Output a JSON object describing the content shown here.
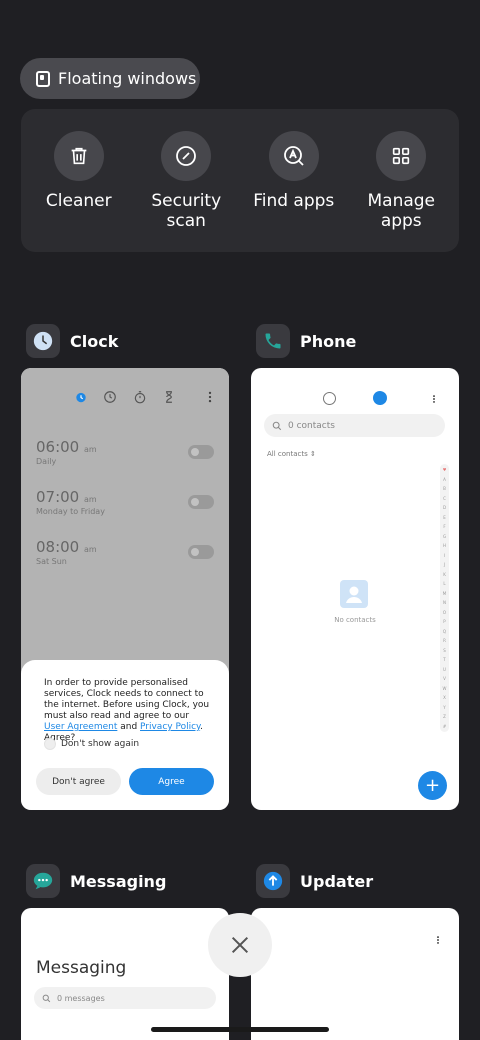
{
  "floating_windows": {
    "label": "Floating windows"
  },
  "quick_actions": [
    {
      "label": "Cleaner",
      "icon": "trash-icon"
    },
    {
      "label": "Security\nscan",
      "icon": "security-scan-icon"
    },
    {
      "label": "Find apps",
      "icon": "find-apps-icon"
    },
    {
      "label": "Manage\napps",
      "icon": "grid-icon"
    }
  ],
  "apps": {
    "clock": {
      "name": "Clock",
      "alarms": [
        {
          "time": "06:00",
          "ampm": "am",
          "repeat": "Daily"
        },
        {
          "time": "07:00",
          "ampm": "am",
          "repeat": "Monday to Friday"
        },
        {
          "time": "08:00",
          "ampm": "am",
          "repeat": "Sat Sun"
        }
      ],
      "consent": {
        "text_before": "In order to provide personalised services, Clock needs to connect to the internet. Before using Clock, you must also read and agree to our ",
        "link_user_agreement": "User Agreement",
        "text_and": " and ",
        "link_privacy_policy": "Privacy Policy",
        "text_after": ". Agree?",
        "checkbox_label": "Don't show again",
        "disagree_label": "Don't agree",
        "agree_label": "Agree"
      }
    },
    "phone": {
      "name": "Phone",
      "search_placeholder": "0 contacts",
      "filter_label": "All contacts",
      "index_letters": [
        "♥",
        "A",
        "B",
        "C",
        "D",
        "E",
        "F",
        "G",
        "H",
        "I",
        "J",
        "K",
        "L",
        "M",
        "N",
        "O",
        "P",
        "Q",
        "R",
        "S",
        "T",
        "U",
        "V",
        "W",
        "X",
        "Y",
        "Z",
        "#"
      ],
      "empty_text": "No contacts",
      "fab_label": "+"
    },
    "messaging": {
      "name": "Messaging",
      "title": "Messaging",
      "search_placeholder": "0 messages"
    },
    "updater": {
      "name": "Updater"
    }
  },
  "colors": {
    "background": "#1f1f23",
    "accent": "#1e88e5",
    "messaging_icon": "#26a69a",
    "phone_icon": "#26a69a",
    "updater_icon": "#1e88e5"
  }
}
